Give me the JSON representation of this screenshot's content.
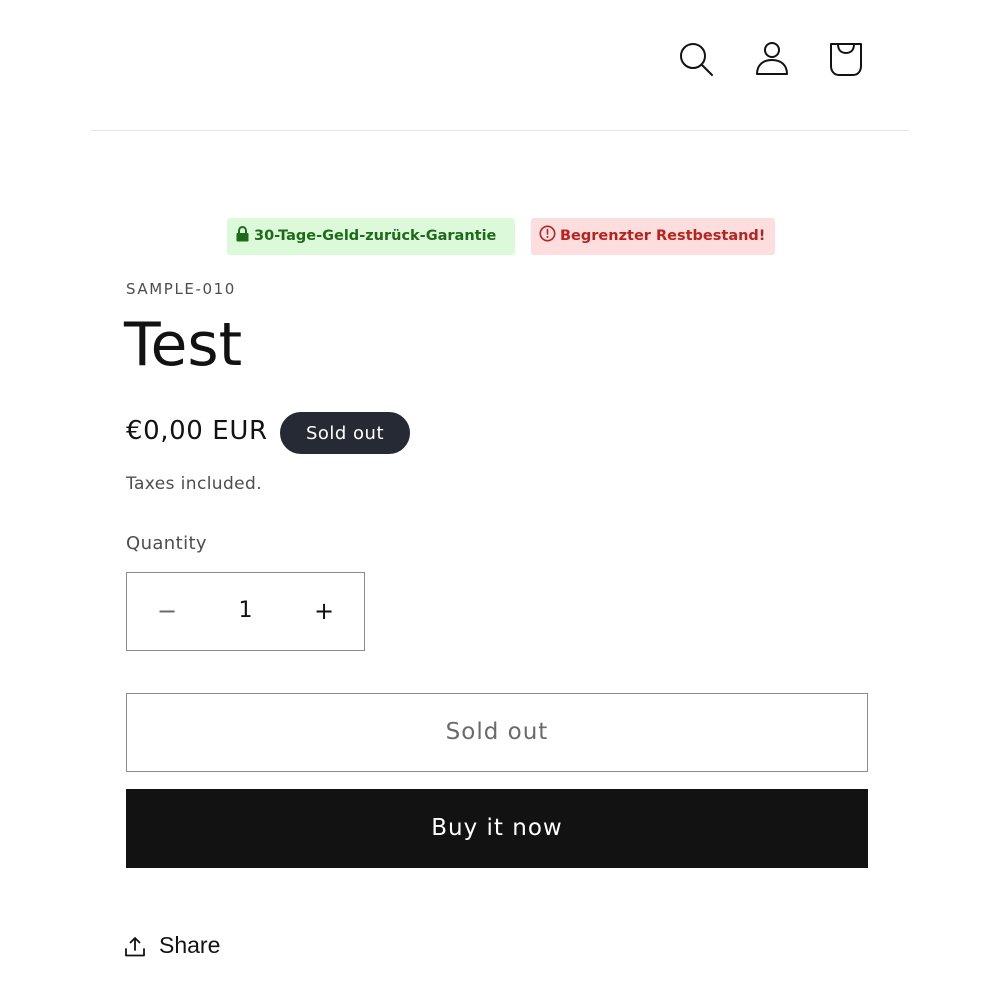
{
  "header": {
    "icons": [
      "search-icon",
      "account-icon",
      "cart-icon"
    ]
  },
  "badges": {
    "guarantee": {
      "text": "30-Tage-Geld-zurück-Garantie",
      "icon": "lock-icon",
      "color": "#1d6b1a",
      "background": "#dcf9d9"
    },
    "stock": {
      "text": "Begrenzter Restbestand!",
      "icon": "clock-icon",
      "color": "#b8231f",
      "background": "#fbdedd"
    }
  },
  "product": {
    "sku": "SAMPLE-010",
    "title": "Test",
    "price": "€0,00 EUR",
    "status_badge": "Sold out",
    "taxes_note": "Taxes included."
  },
  "quantity": {
    "label": "Quantity",
    "value": "1",
    "minus": "−",
    "plus": "+"
  },
  "actions": {
    "add_to_cart_label": "Sold out",
    "buy_now_label": "Buy it now"
  },
  "share": {
    "label": "Share",
    "icon": "share-icon"
  },
  "colors": {
    "accent_dark": "#121212",
    "badge_dark": "#262a35"
  }
}
